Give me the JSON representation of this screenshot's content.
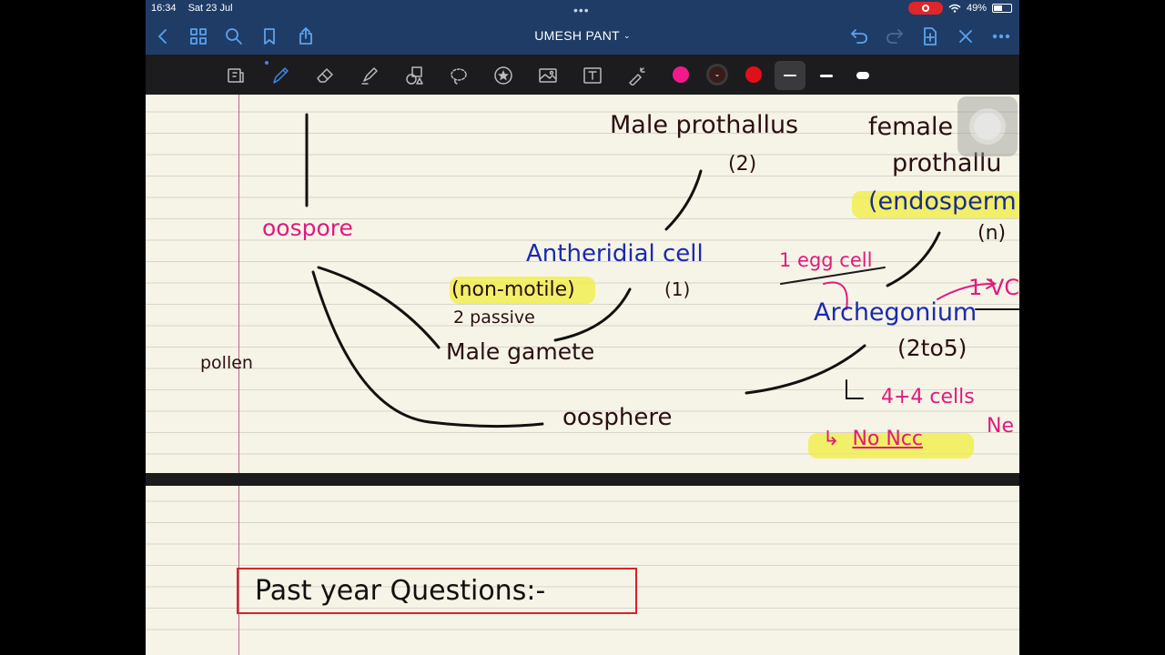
{
  "status_bar": {
    "time": "16:34",
    "date": "Sat 23 Jul",
    "battery": "49%",
    "battery_level": 0.49,
    "recording_color": "#e0262a"
  },
  "nav": {
    "title": "UMESH PANT",
    "left_icons": [
      "back-icon",
      "grid-icon",
      "search-icon",
      "bookmark-icon",
      "share-icon"
    ],
    "right_icons": [
      "undo-icon",
      "redo-icon",
      "add-page-icon",
      "close-icon",
      "more-icon"
    ]
  },
  "toolbar": {
    "tools": [
      "lasso-scan-icon",
      "pen-icon",
      "eraser-icon",
      "highlighter-icon",
      "shapes-icon",
      "lasso-icon",
      "sticker-icon",
      "image-icon",
      "text-box-icon",
      "laser-pointer-icon"
    ],
    "active_tool": "pen-icon",
    "colors": [
      "#f01a8a",
      "#3a1a1a",
      "#e0101a"
    ],
    "selected_color": "#3a1a1a"
  },
  "page1": {
    "oospore": "oospore",
    "male_prothallus": "Male prothallus",
    "male_prothallus_ploidy": "(2)",
    "female": "female",
    "prothallus": "prothallu",
    "endosperm": "(endosperm",
    "female_ploidy": "(n)",
    "antheridial_cell": "Antheridial cell",
    "antheridial_ploidy": "(1)",
    "non_motile": "(non-motile)",
    "passive": "2 passive",
    "male_gamete": "Male gamete",
    "egg_cell": "1 egg cell",
    "lvc": "1 VC",
    "archegonium": "Archegonium",
    "archegonium_count": "(2to5)",
    "cells": "4+4 cells",
    "ne": "Ne",
    "no_ncc": "No Ncc",
    "oosphere": "oosphere",
    "margin_note": "pollen",
    "highlight_color": "#f0ee3d"
  },
  "page2": {
    "heading": "Past year Questions:-",
    "box_color": "#d8232a"
  }
}
